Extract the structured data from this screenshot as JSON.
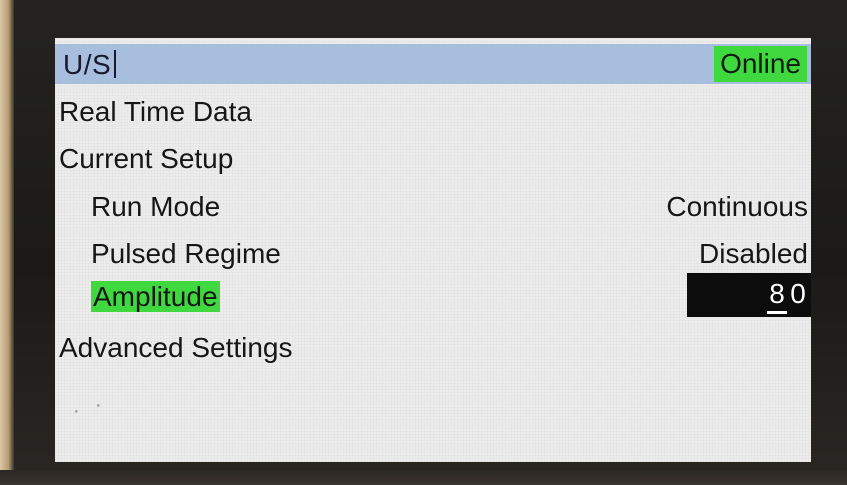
{
  "header": {
    "title": "U/S",
    "status": "Online",
    "status_color": "#3fd83f"
  },
  "menu": {
    "real_time_data": "Real Time Data",
    "current_setup": "Current Setup",
    "run_mode_label": "Run Mode",
    "run_mode_value": "Continuous",
    "pulsed_regime_label": "Pulsed Regime",
    "pulsed_regime_value": "Disabled",
    "amplitude_label": "Amplitude",
    "amplitude_digit_1": "8",
    "amplitude_digit_2": "0",
    "advanced_settings": "Advanced Settings"
  },
  "colors": {
    "title_bar": "#a8bedf",
    "selection_highlight": "#3fd83f",
    "screen_background": "#ececec",
    "edit_box": "#0c0c0c"
  }
}
